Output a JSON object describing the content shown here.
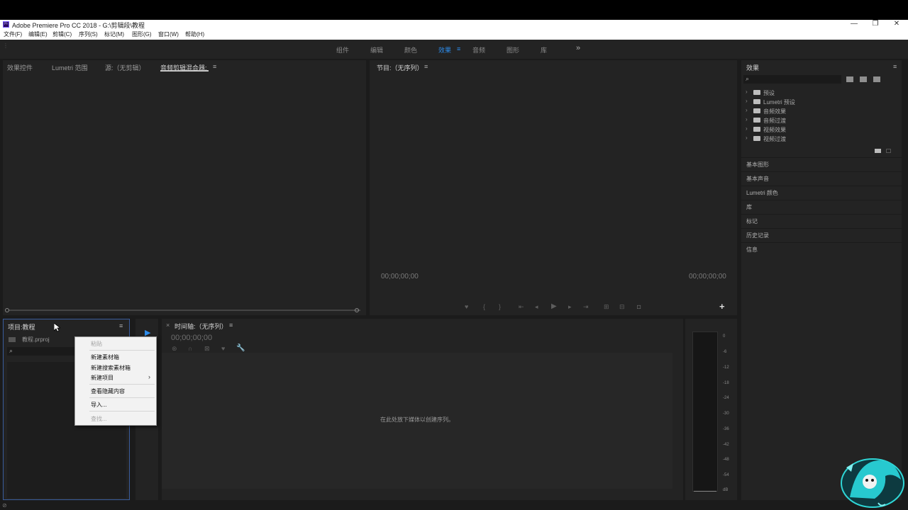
{
  "window": {
    "title": "Adobe Premiere Pro CC 2018 - G:\\剪辑段\\教程",
    "app_icon_text": "Pr",
    "minimize_glyph": "—",
    "restore_glyph": "❐",
    "close_glyph": "✕"
  },
  "menubar": {
    "items": [
      "文件(F)",
      "编辑(E)",
      "剪辑(C)",
      "序列(S)",
      "标记(M)",
      "图形(G)",
      "窗口(W)",
      "帮助(H)"
    ]
  },
  "workspaces": {
    "tabs": [
      "组件",
      "编辑",
      "颜色",
      "效果",
      "音频",
      "图形",
      "库"
    ],
    "active": "效果",
    "overflow_glyph": "»",
    "accent_color": "#2d8ceb"
  },
  "source_panel": {
    "tabs": [
      "效果控件",
      "Lumetri 范围",
      "源:（无剪辑）",
      "音频剪辑混合器:"
    ],
    "active_tab": "音频剪辑混合器:"
  },
  "program_panel": {
    "title": "节目:（无序列）",
    "timecode_left": "00;00;00;00",
    "timecode_right": "00;00;00;00",
    "add_glyph": "+"
  },
  "effects_panel": {
    "title": "效果",
    "search_placeholder": "",
    "items": [
      "预设",
      "Lumetri 预设",
      "音频效果",
      "音频过渡",
      "视频效果",
      "视频过渡"
    ]
  },
  "side_panels": [
    "基本图形",
    "基本声音",
    "Lumetri 颜色",
    "库",
    "标记",
    "历史记录",
    "信息"
  ],
  "project_panel": {
    "title": "项目:教程",
    "file_name": "教程.prproj"
  },
  "timeline_panel": {
    "title": "时间轴:（无序列）",
    "timecode": "00;00;00;00",
    "drop_hint": "在此处放下媒体以创建序列。"
  },
  "context_menu": {
    "items": [
      {
        "label": "粘贴",
        "enabled": false
      },
      {
        "label": "新建素材箱",
        "enabled": true
      },
      {
        "label": "新建搜索素材箱",
        "enabled": true
      },
      {
        "label": "新建项目",
        "enabled": true,
        "submenu": true
      },
      {
        "label": "查看隐藏内容",
        "enabled": true
      },
      {
        "label": "导入...",
        "enabled": true
      },
      {
        "label": "查找...",
        "enabled": false
      }
    ],
    "submenu_glyph": "›"
  },
  "audio_meter": {
    "ticks": [
      "0",
      "-6",
      "-12",
      "-18",
      "-24",
      "-30",
      "-36",
      "-42",
      "-48",
      "-54",
      "dB"
    ]
  }
}
